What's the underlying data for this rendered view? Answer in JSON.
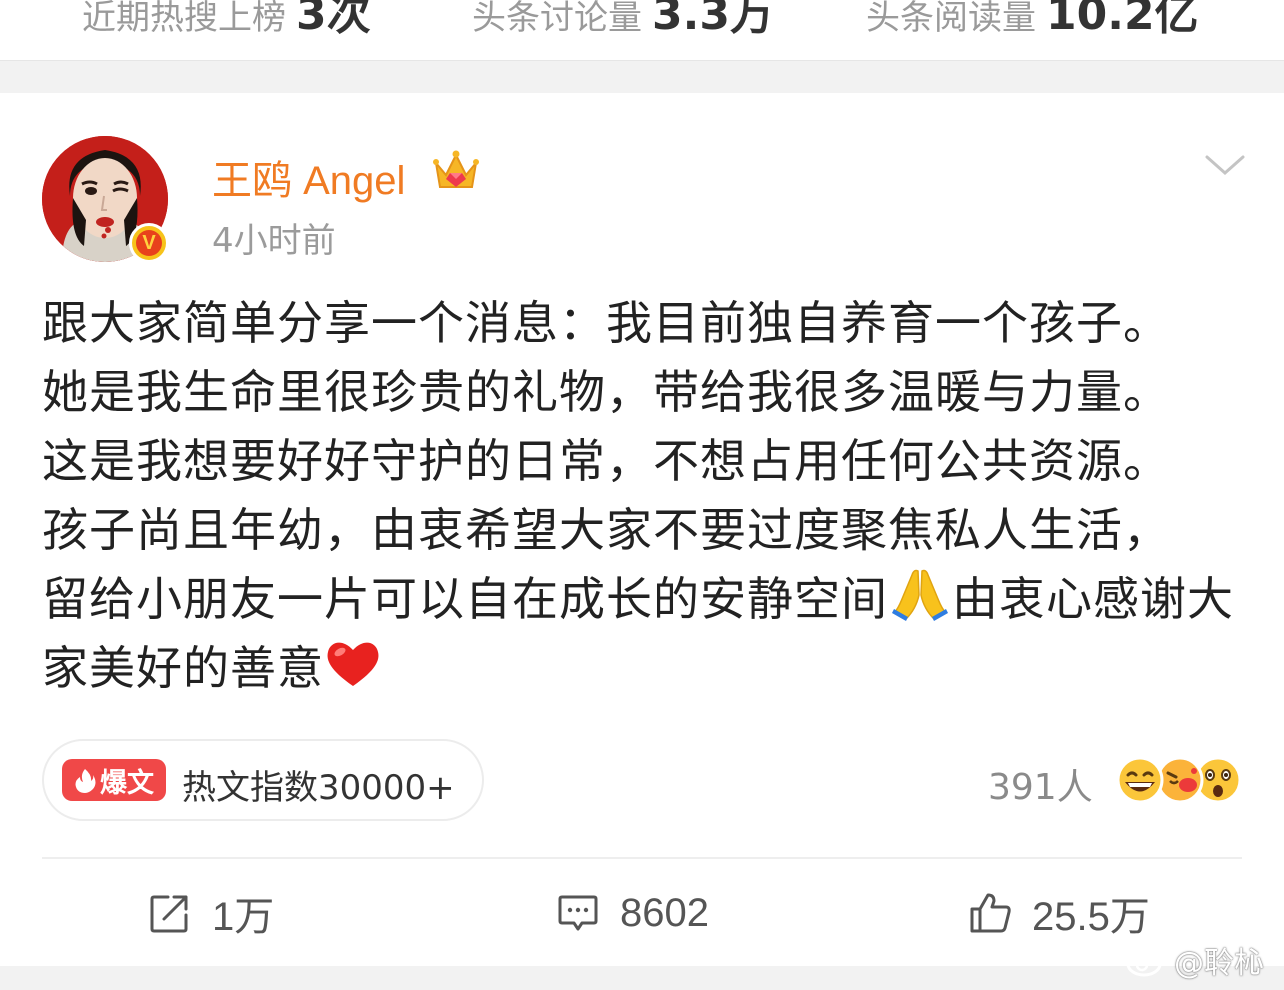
{
  "top_stats": [
    {
      "label": "近期热搜上榜",
      "value": "3次"
    },
    {
      "label": "头条讨论量",
      "value": "3.3万"
    },
    {
      "label": "头条阅读量",
      "value": "10.2亿"
    }
  ],
  "post": {
    "author": "王鸥 Angel",
    "time": "4小时前",
    "text_lines": [
      "跟大家简单分享一个消息：我目前独自养育一个孩子。",
      "她是我生命里很珍贵的礼物，带给我很多温暖与力量。",
      "这是我想要好好守护的日常，不想占用任何公共资源。",
      "孩子尚且年幼，由衷希望大家不要过度聚焦私人生活，",
      "留给小朋友一片可以自在成长的安静空间",
      "由衷心感谢大",
      "家美好的善意"
    ],
    "hot_tag": "爆文",
    "hot_index_text": "热文指数30000+",
    "reactions_count": "391人",
    "actions": {
      "repost": "1万",
      "comment": "8602",
      "like": "25.5万"
    }
  },
  "watermark": "@聆杺",
  "colors": {
    "author_orange": "#f07b23",
    "hot_red": "#f04848",
    "badge_yellow": "#f7c31a"
  },
  "icons": [
    "crown-icon",
    "verified-badge-icon",
    "chevron-down-icon",
    "pray-emoji-icon",
    "heart-emoji-icon",
    "flame-icon",
    "reaction-faces-icon",
    "repost-icon",
    "comment-icon",
    "like-icon",
    "weibo-eye-icon"
  ]
}
